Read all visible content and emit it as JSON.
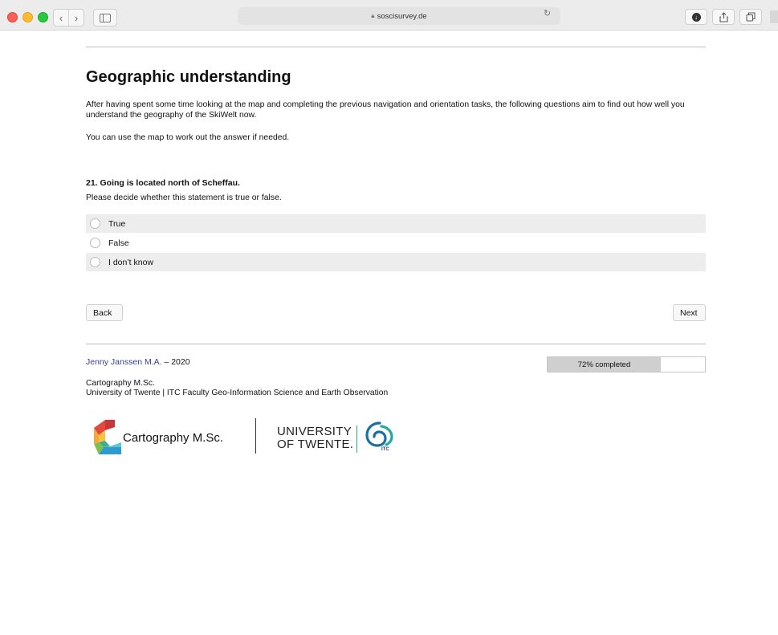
{
  "browser": {
    "url": "soscisurvey.de",
    "lock_icon": "lock-icon",
    "icons": [
      "back-arrow-icon",
      "forward-arrow-icon",
      "sidebar-icon",
      "reload-icon",
      "download-icon",
      "share-icon",
      "tabs-icon"
    ]
  },
  "page": {
    "title": "Geographic understanding",
    "intro": "After having spent some time looking at the map and completing the previous navigation and orientation tasks, the following questions aim to find out how well you understand the geography of the SkiWelt now.",
    "intro2": "You can use the map to work out the answer if needed."
  },
  "question": {
    "title": "21. Going is located north of Scheffau.",
    "instruction": "Please decide whether this statement is true or false.",
    "options": [
      {
        "label": "True"
      },
      {
        "label": "False"
      },
      {
        "label": "I don’t know"
      }
    ]
  },
  "nav": {
    "back_label": "Back",
    "next_label": "Next"
  },
  "footer": {
    "author_link": "Jenny Janssen M.A.",
    "author_suffix": " – 2020",
    "progress_text": "72% completed",
    "progress_value": 0.72,
    "line1": "Cartography M.Sc.",
    "line2": "University of Twente | ITC Faculty Geo-Information Science and Earth Observation",
    "logo_cartography": "Cartography M.Sc.",
    "logo_ut_line1": "UNIVERSITY",
    "logo_ut_line2": "OF TWENTE.",
    "logo_itc": "ITC"
  },
  "colors": {
    "link": "#3a3f8f",
    "option_shade": "#ededed",
    "progress_fill": "#cfcfcf",
    "itc_blue": "#1c6ea4",
    "itc_teal": "#28a8a0"
  }
}
